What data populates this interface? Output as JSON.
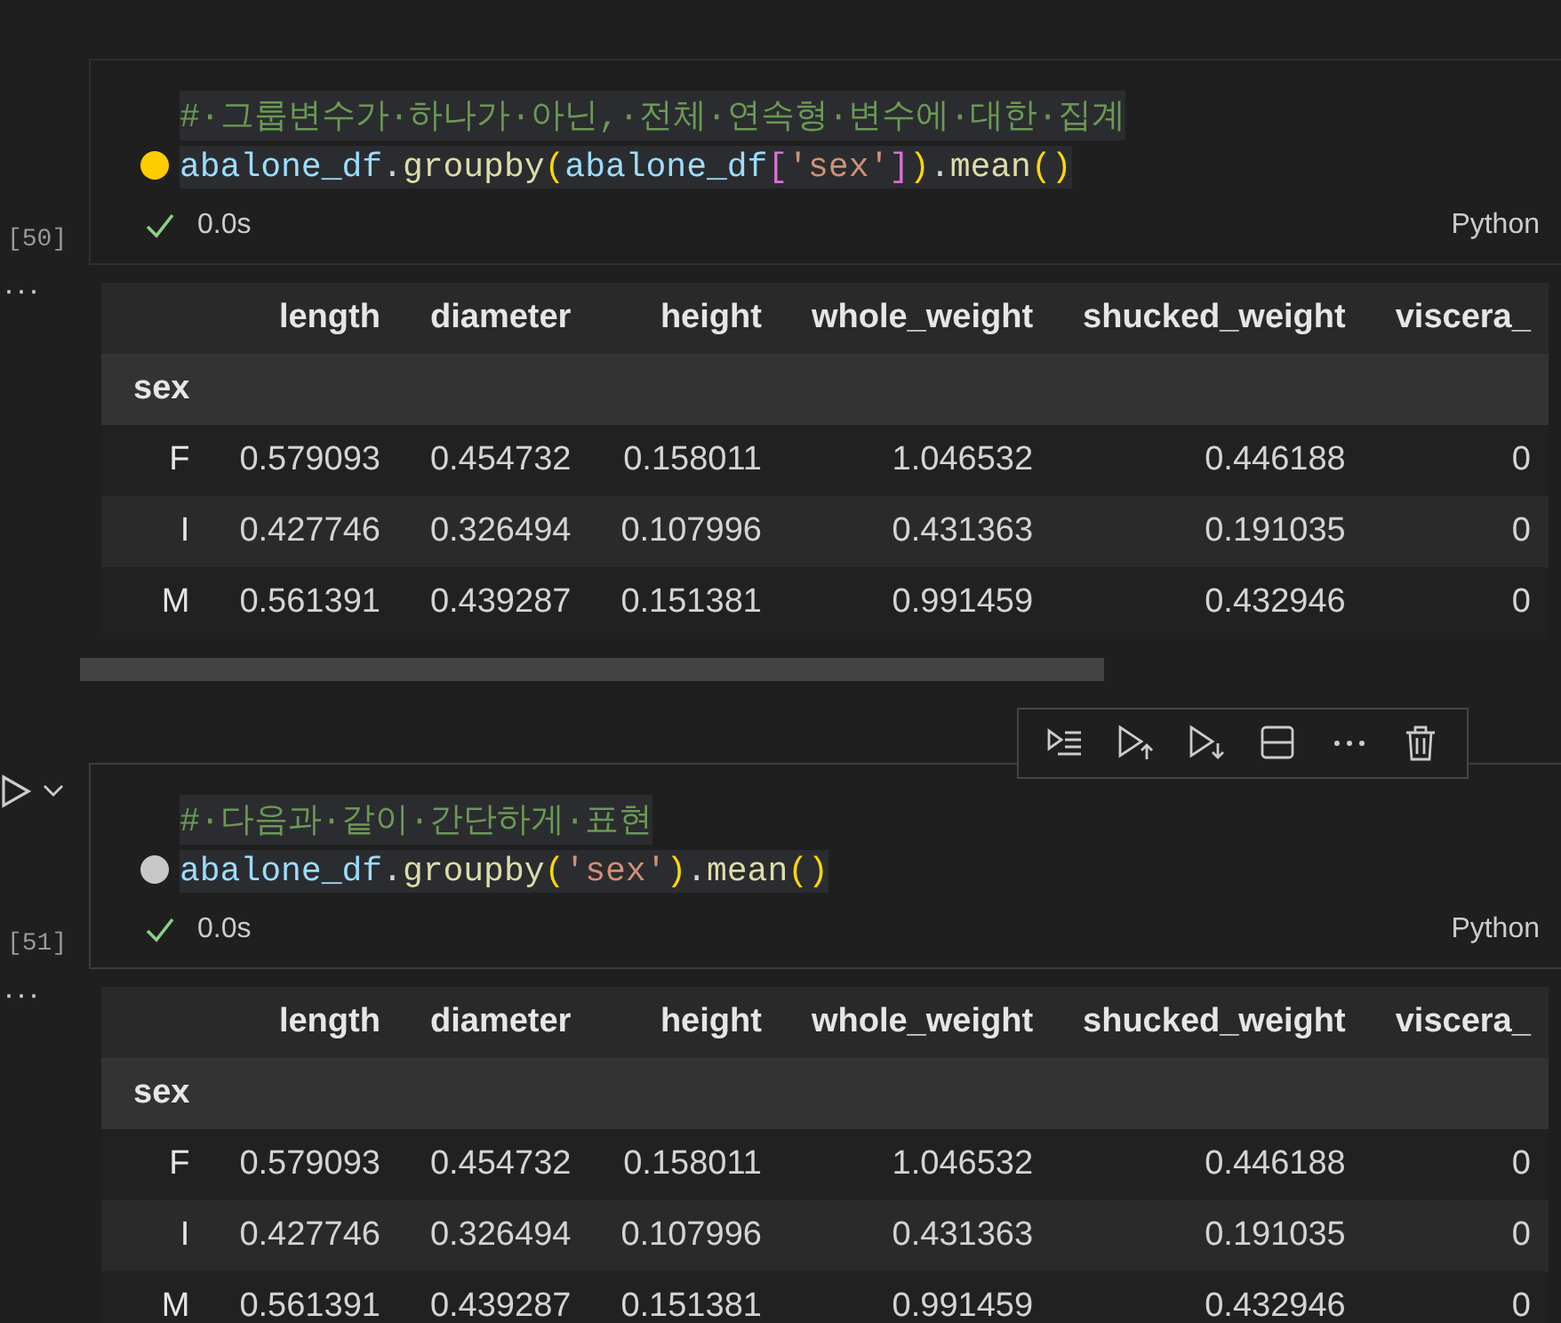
{
  "cells": [
    {
      "count": "[50]",
      "focused": false,
      "hint": {
        "kind": "lightbulb"
      },
      "status": {
        "succeeded": true,
        "time": "0.0s",
        "language": "Python"
      },
      "lines": [
        [
          {
            "kind": "comment",
            "text": "#·그룹변수가·하나가·아닌,·전체·연속형·변수에·대한·집계"
          }
        ],
        [
          {
            "kind": "var",
            "text": "abalone_df"
          },
          {
            "kind": "punct",
            "text": "."
          },
          {
            "kind": "method",
            "text": "groupby"
          },
          {
            "kind": "bracket1",
            "text": "("
          },
          {
            "kind": "var",
            "text": "abalone_df"
          },
          {
            "kind": "bracket2",
            "text": "["
          },
          {
            "kind": "string",
            "text": "'sex'"
          },
          {
            "kind": "bracket2",
            "text": "]"
          },
          {
            "kind": "bracket1",
            "text": ")"
          },
          {
            "kind": "punct",
            "text": "."
          },
          {
            "kind": "method",
            "text": "mean"
          },
          {
            "kind": "bracket1",
            "text": "()"
          }
        ]
      ],
      "output": {
        "more": "···",
        "scrollbar": true,
        "index_name": "sex",
        "columns": [
          "length",
          "diameter",
          "height",
          "whole_weight",
          "shucked_weight",
          "viscera_"
        ],
        "rows": [
          {
            "index": "F",
            "values": [
              "0.579093",
              "0.454732",
              "0.158011",
              "1.046532",
              "0.446188",
              "0"
            ]
          },
          {
            "index": "I",
            "values": [
              "0.427746",
              "0.326494",
              "0.107996",
              "0.431363",
              "0.191035",
              "0"
            ]
          },
          {
            "index": "M",
            "values": [
              "0.561391",
              "0.439287",
              "0.151381",
              "0.991459",
              "0.432946",
              "0"
            ]
          }
        ]
      }
    },
    {
      "count": "[51]",
      "focused": true,
      "hint": {
        "kind": "dot"
      },
      "status": {
        "succeeded": true,
        "time": "0.0s",
        "language": "Python"
      },
      "lines": [
        [
          {
            "kind": "comment",
            "text": "#·다음과·같이·간단하게·표현"
          }
        ],
        [
          {
            "kind": "var",
            "text": "abalone_df"
          },
          {
            "kind": "punct",
            "text": "."
          },
          {
            "kind": "method",
            "text": "groupby"
          },
          {
            "kind": "bracket1",
            "text": "("
          },
          {
            "kind": "string",
            "text": "'sex'"
          },
          {
            "kind": "bracket1",
            "text": ")"
          },
          {
            "kind": "punct",
            "text": "."
          },
          {
            "kind": "method",
            "text": "mean"
          },
          {
            "kind": "bracket1",
            "text": "()"
          }
        ]
      ],
      "output": {
        "more": "···",
        "index_name": "sex",
        "columns": [
          "length",
          "diameter",
          "height",
          "whole_weight",
          "shucked_weight",
          "viscera_"
        ],
        "rows": [
          {
            "index": "F",
            "values": [
              "0.579093",
              "0.454732",
              "0.158011",
              "1.046532",
              "0.446188",
              "0"
            ]
          },
          {
            "index": "I",
            "values": [
              "0.427746",
              "0.326494",
              "0.107996",
              "0.431363",
              "0.191035",
              "0"
            ]
          },
          {
            "index": "M",
            "values": [
              "0.561391",
              "0.439287",
              "0.151381",
              "0.991459",
              "0.432946",
              "0"
            ]
          }
        ]
      }
    }
  ]
}
